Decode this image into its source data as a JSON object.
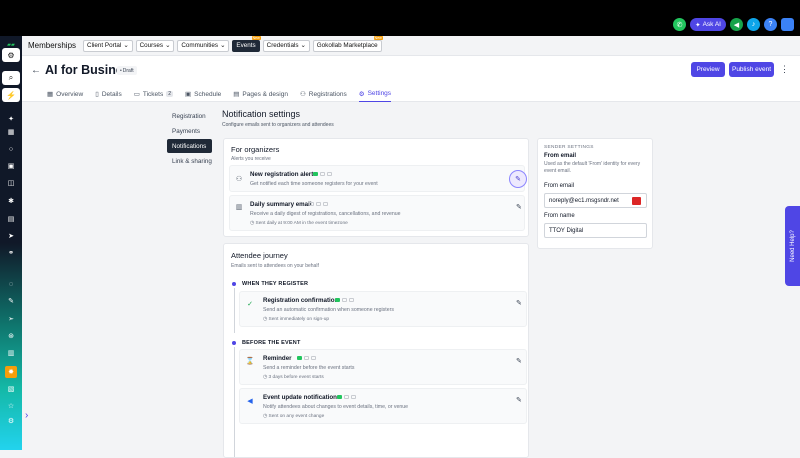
{
  "topbar": {
    "ask_ai": "Ask AI",
    "sidebar_logo_text": ""
  },
  "subnav": {
    "title": "Memberships",
    "items": [
      {
        "label": "Client Portal",
        "dropdown": true
      },
      {
        "label": "Courses",
        "dropdown": true
      },
      {
        "label": "Communities",
        "dropdown": true
      },
      {
        "label": "Events",
        "active": true,
        "badge": "New"
      },
      {
        "label": "Credentials",
        "dropdown": true
      },
      {
        "label": "Gokollab Marketplace",
        "badge": "New"
      }
    ]
  },
  "header": {
    "title": "AI for Business",
    "status": "Draft",
    "preview": "Preview",
    "publish": "Publish event"
  },
  "tabs": [
    {
      "label": "Overview",
      "icon": "grid-icon"
    },
    {
      "label": "Details",
      "icon": "document-icon"
    },
    {
      "label": "Tickets",
      "icon": "ticket-icon",
      "count": "2"
    },
    {
      "label": "Schedule",
      "icon": "calendar-icon"
    },
    {
      "label": "Pages & design",
      "icon": "layout-icon"
    },
    {
      "label": "Registrations",
      "icon": "users-icon"
    },
    {
      "label": "Settings",
      "icon": "gear-icon",
      "active": true
    }
  ],
  "left_nav": {
    "items": [
      "Registration",
      "Payments",
      "Notifications",
      "Link & sharing"
    ],
    "active": "Notifications"
  },
  "notification": {
    "title": "Notification settings",
    "subtitle": "Configure emails sent to organizers and attendees"
  },
  "organizers": {
    "title": "For organizers",
    "subtitle": "Alerts you receive",
    "rows": [
      {
        "title": "New registration alert",
        "desc": "Get notified each time someone registers for your event",
        "icon": "user-plus-icon"
      },
      {
        "title": "Daily summary email",
        "desc": "Receive a daily digest of registrations, cancellations, and revenue",
        "meta": "Sent daily at 9:00 AM in the event timezone",
        "icon": "bar-chart-icon"
      }
    ]
  },
  "attendee": {
    "title": "Attendee journey",
    "subtitle": "Emails sent to attendees on your behalf",
    "phases": [
      {
        "label": "WHEN THEY REGISTER",
        "rows": [
          {
            "title": "Registration confirmation",
            "desc": "Send an automatic confirmation when someone registers",
            "meta": "Sent immediately on sign-up",
            "icon": "check-circle-icon"
          }
        ]
      },
      {
        "label": "BEFORE THE EVENT",
        "rows": [
          {
            "title": "Reminder",
            "desc": "Send a reminder before the event starts",
            "meta": "3 days before event starts",
            "icon": "hourglass-icon"
          },
          {
            "title": "Event update notifications",
            "desc": "Notify attendees about changes to event details, time, or venue",
            "meta": "Sent on any event change",
            "icon": "megaphone-icon"
          }
        ]
      }
    ]
  },
  "sender": {
    "heading": "SENDER SETTINGS",
    "from_email_title": "From email",
    "from_email_desc": "Used as the default 'From' identity for every event email.",
    "from_email_label": "From email",
    "from_email_value": "noreply@ec1.msgsndr.net",
    "from_name_label": "From name",
    "from_name_value": "TTOY Digital"
  },
  "help": {
    "label": "Need Help?"
  },
  "colors": {
    "accent": "#4f46e5",
    "sidebar": "#101828",
    "channel_email": "#22c55e"
  }
}
